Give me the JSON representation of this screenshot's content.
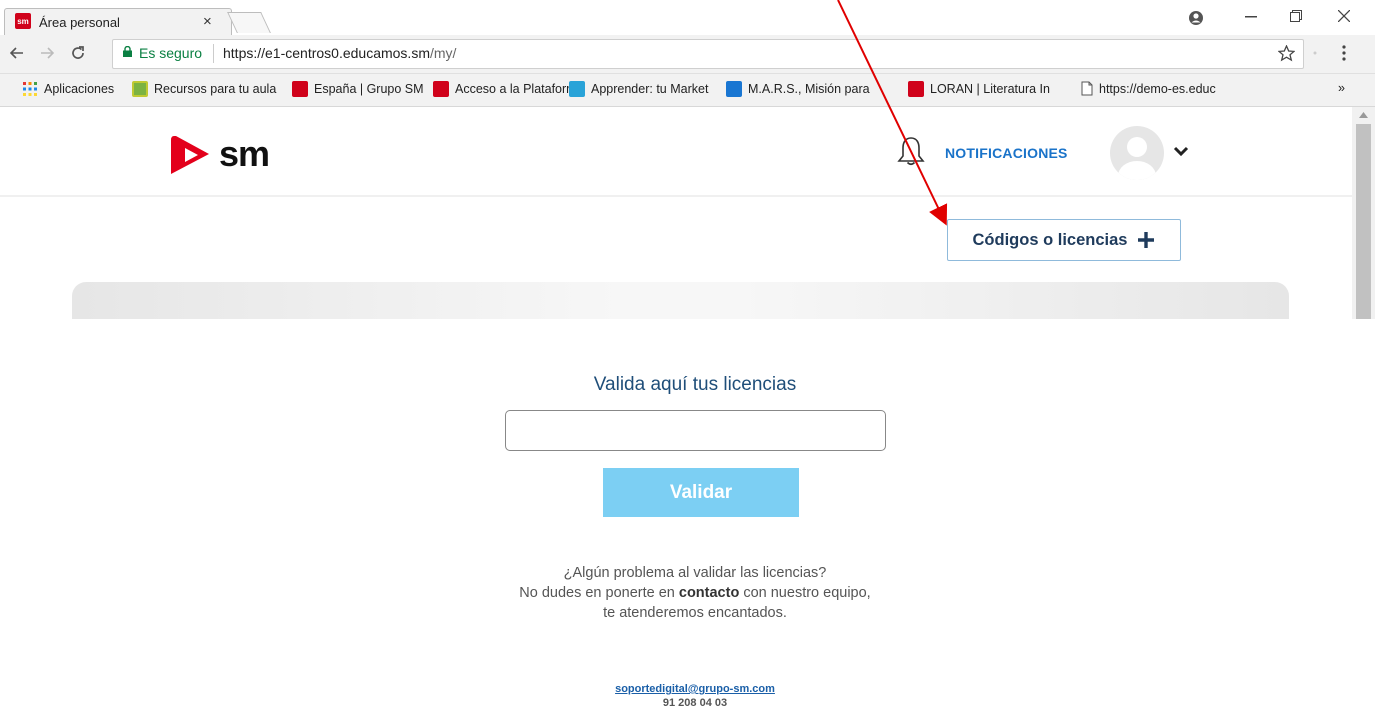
{
  "browser": {
    "tab_title": "Área personal",
    "tab_close": "×",
    "secure_label": "Es seguro",
    "url_host": "https://e1-centros0.educamos.sm",
    "url_path": "/my/",
    "bookmarks": [
      {
        "label": "Aplicaciones",
        "icon": "apps-grid-icon"
      },
      {
        "label": "Recursos para tu aula",
        "icon": "recursos-icon"
      },
      {
        "label": "España | Grupo SM",
        "icon": "sm-favicon"
      },
      {
        "label": "Acceso a la Plataform",
        "icon": "sm-favicon"
      },
      {
        "label": "Apprender: tu Market",
        "icon": "apprender-icon"
      },
      {
        "label": "M.A.R.S., Misión para",
        "icon": "mars-icon"
      },
      {
        "label": "LORAN | Literatura In",
        "icon": "sm-favicon"
      },
      {
        "label": "https://demo-es.educ",
        "icon": "page-icon"
      }
    ],
    "bookmarks_overflow": "»"
  },
  "header": {
    "logo_text": "sm",
    "notifications_label": "NOTIFICACIONES"
  },
  "main": {
    "codes_button_label": "Códigos o licencias",
    "validate_title": "Valida aquí tus licencias",
    "license_input_value": "",
    "validate_button_label": "Validar",
    "help_line1": "¿Algún problema al validar las licencias?",
    "help_line2_pre": "No dudes en ponerte en ",
    "help_line2_bold": "contacto",
    "help_line2_post": " con nuestro equipo,",
    "help_line3": "te atenderemos encantados.",
    "support_email": "soportedigital@grupo-sm.com",
    "support_phone": "91 208 04 03"
  },
  "colors": {
    "brand_red": "#d0021b",
    "accent_blue": "#1a73c9",
    "validate_button": "#7ccff3",
    "annotation_arrow": "#e00000"
  }
}
